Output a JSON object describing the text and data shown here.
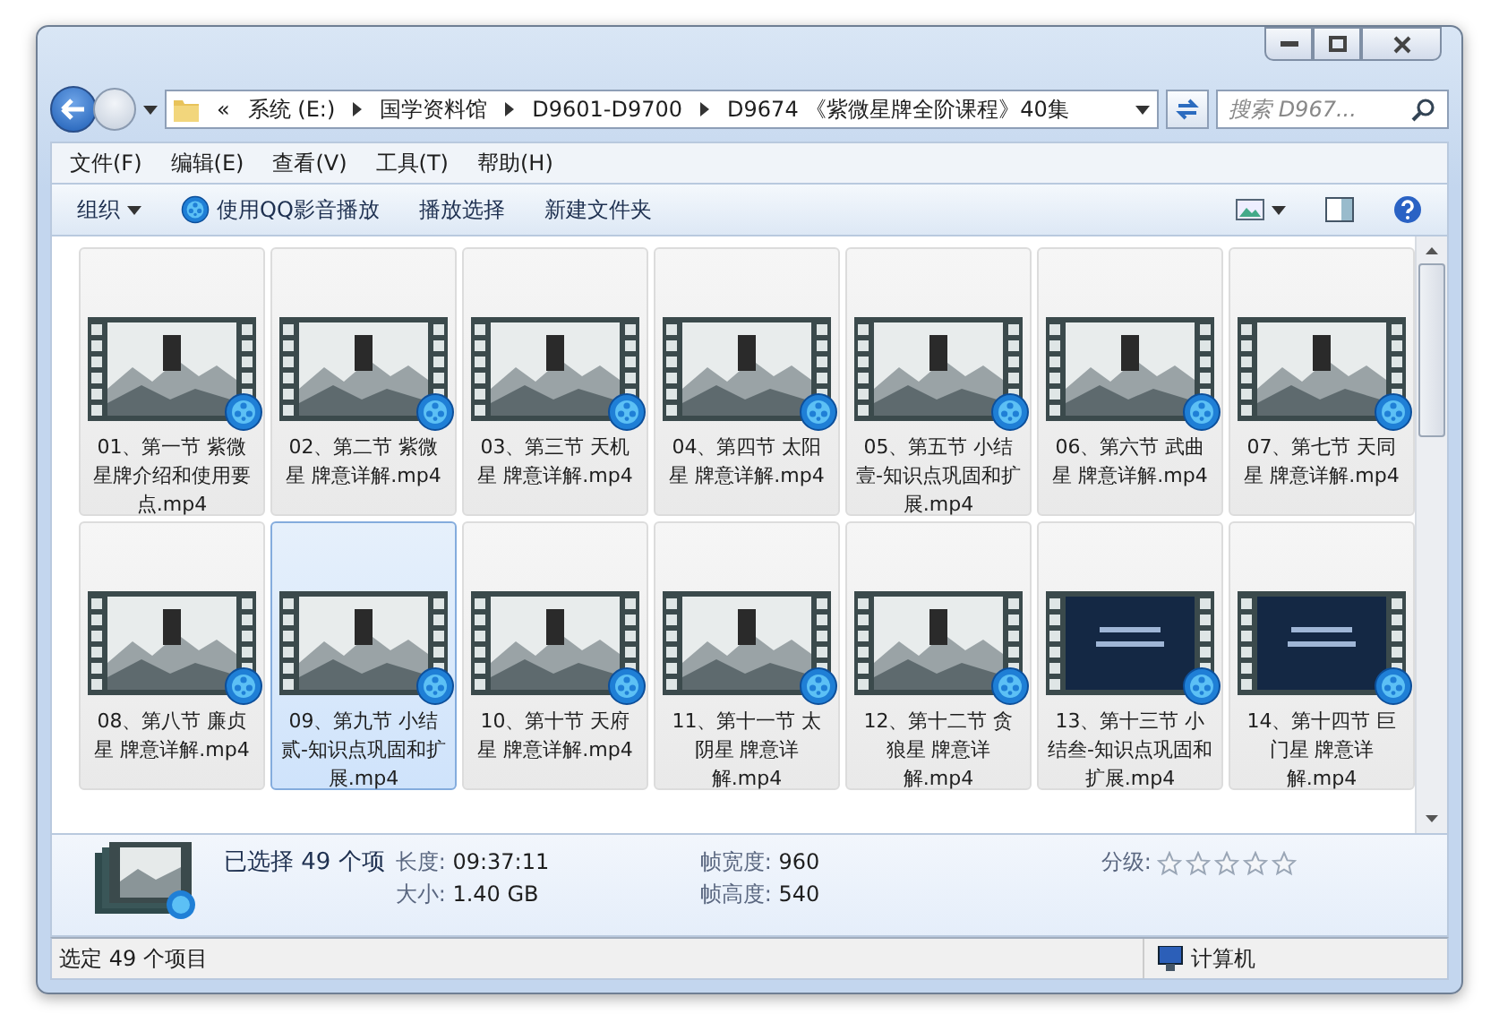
{
  "address_bar": {
    "overflow": "«",
    "path": [
      "系统 (E:)",
      "国学资料馆",
      "D9601-D9700",
      "D9674 《紫微星牌全阶课程》40集"
    ]
  },
  "search": {
    "placeholder": "搜索 D967..."
  },
  "menu_bar": [
    "文件(F)",
    "编辑(E)",
    "查看(V)",
    "工具(T)",
    "帮助(H)"
  ],
  "toolbar": [
    {
      "label": "组织",
      "kind": "dropdown"
    },
    {
      "label": "使用QQ影音播放",
      "kind": "play"
    },
    {
      "label": "播放选择",
      "kind": "plain"
    },
    {
      "label": "新建文件夹",
      "kind": "plain"
    }
  ],
  "files": [
    {
      "name": "01、第一节 紫微星牌介绍和使用要点.mp4",
      "kind": "landscape",
      "selected": true,
      "hovered": false
    },
    {
      "name": "02、第二节 紫微星 牌意详解.mp4",
      "kind": "landscape",
      "selected": true,
      "hovered": false
    },
    {
      "name": "03、第三节 天机星 牌意详解.mp4",
      "kind": "landscape",
      "selected": true,
      "hovered": false
    },
    {
      "name": "04、第四节 太阳星 牌意详解.mp4",
      "kind": "landscape",
      "selected": true,
      "hovered": false
    },
    {
      "name": "05、第五节 小结壹-知识点巩固和扩展.mp4",
      "kind": "landscape",
      "selected": true,
      "hovered": false
    },
    {
      "name": "06、第六节 武曲星 牌意详解.mp4",
      "kind": "landscape",
      "selected": true,
      "hovered": false
    },
    {
      "name": "07、第七节 天同星 牌意详解.mp4",
      "kind": "landscape",
      "selected": true,
      "hovered": false
    },
    {
      "name": "08、第八节 廉贞星 牌意详解.mp4",
      "kind": "landscape",
      "selected": true,
      "hovered": false
    },
    {
      "name": "09、第九节 小结贰-知识点巩固和扩展.mp4",
      "kind": "landscape",
      "selected": true,
      "hovered": true
    },
    {
      "name": "10、第十节 天府星 牌意详解.mp4",
      "kind": "landscape",
      "selected": true,
      "hovered": false
    },
    {
      "name": "11、第十一节 太阴星 牌意详解.mp4",
      "kind": "landscape",
      "selected": true,
      "hovered": false
    },
    {
      "name": "12、第十二节 贪狼星 牌意详解.mp4",
      "kind": "landscape",
      "selected": true,
      "hovered": false
    },
    {
      "name": "13、第十三节 小结叁-知识点巩固和扩展.mp4",
      "kind": "starfield",
      "selected": true,
      "hovered": false
    },
    {
      "name": "14、第十四节 巨门星 牌意详解.mp4",
      "kind": "starfield",
      "selected": true,
      "hovered": false
    }
  ],
  "details": {
    "summary": "已选择 49 个项",
    "properties": [
      {
        "label": "长度:",
        "value": "09:37:11"
      },
      {
        "label": "大小:",
        "value": "1.40 GB"
      },
      {
        "label": "帧宽度:",
        "value": "960"
      },
      {
        "label": "帧高度:",
        "value": "540"
      }
    ],
    "rating": {
      "label": "分级:",
      "stars": 0
    }
  },
  "status_bar": {
    "text": "选定 49 个项目",
    "location": "计算机"
  }
}
